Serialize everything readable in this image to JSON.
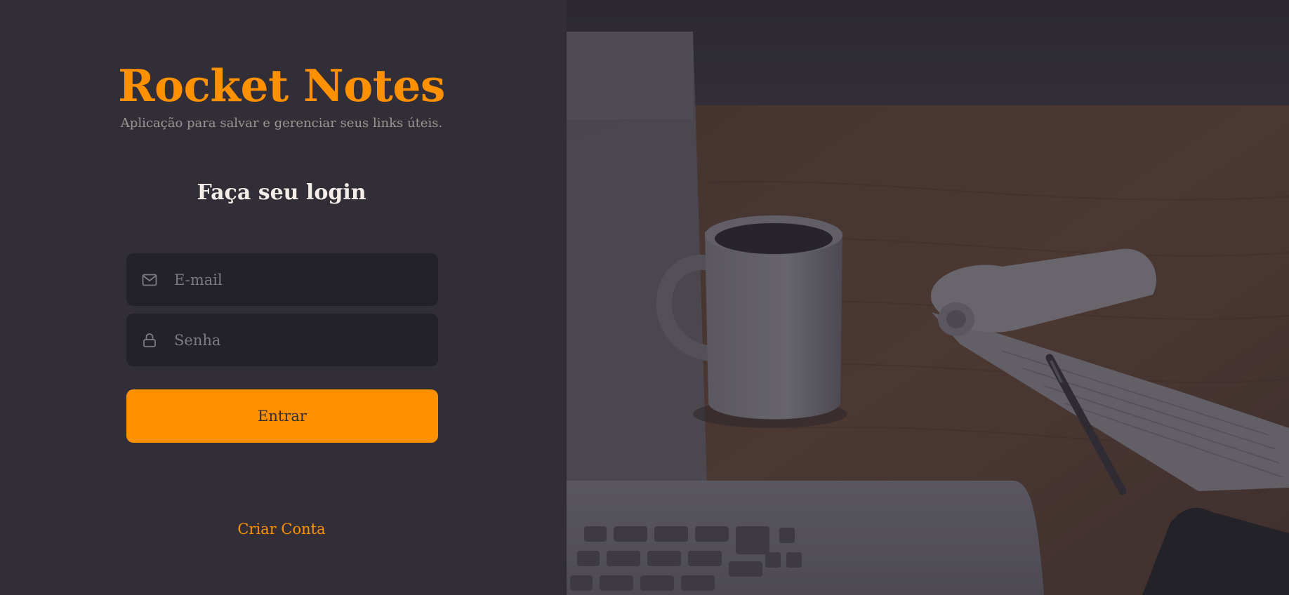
{
  "brand": {
    "title": "Rocket Notes",
    "subtitle": "Aplicação para salvar e gerenciar seus links úteis."
  },
  "form": {
    "heading": "Faça seu login",
    "email": {
      "placeholder": "E-mail",
      "value": "",
      "icon": "mail-icon"
    },
    "password": {
      "placeholder": "Senha",
      "value": "",
      "icon": "lock-icon"
    },
    "submit_label": "Entrar",
    "create_account_label": "Criar Conta"
  },
  "colors": {
    "background": "#312e38",
    "accent": "#ff9000",
    "input_background": "#232129",
    "heading_text": "#f4ede8",
    "muted_text": "#999591"
  }
}
